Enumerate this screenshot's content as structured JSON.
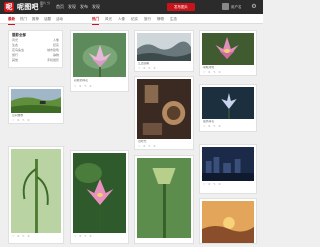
{
  "brand": {
    "logo_letter": "呢",
    "name": "呢图吧",
    "slogan": "图片 分享"
  },
  "topnav": [
    "首页",
    "发现",
    "发布",
    "发现"
  ],
  "top_search_label": "发布图片",
  "user": {
    "name": "用户名"
  },
  "subnav_left": [
    {
      "label": "最新",
      "active": true
    },
    {
      "label": "热门",
      "active": false
    },
    {
      "label": "推荐",
      "active": false
    },
    {
      "label": "话题",
      "active": false
    },
    {
      "label": "活动",
      "active": false
    }
  ],
  "subnav_right": [
    {
      "label": "热门",
      "active": true
    },
    {
      "label": "风光",
      "active": false
    },
    {
      "label": "人像",
      "active": false
    },
    {
      "label": "纪实",
      "active": false
    },
    {
      "label": "旅行",
      "active": false
    },
    {
      "label": "静物",
      "active": false
    },
    {
      "label": "生态",
      "active": false
    }
  ],
  "sidebar": {
    "title": "摄影全部",
    "rows": [
      [
        "风光",
        "人像"
      ],
      [
        "生态",
        "纪实"
      ],
      [
        "花鸟鱼虫",
        "城市建筑"
      ],
      [
        "旅行",
        "静物"
      ],
      [
        "其他",
        "手机摄影"
      ]
    ]
  },
  "cards": [
    {
      "caption": "初夏的荷花",
      "likes": "0",
      "comments": "0"
    },
    {
      "caption": "江边远眺",
      "likes": "0",
      "comments": "0"
    },
    {
      "caption": "荷塘月色",
      "likes": "0",
      "comments": "0"
    },
    {
      "caption": "山间放牧",
      "likes": "0",
      "comments": "0"
    },
    {
      "caption": "旧时光",
      "likes": "0",
      "comments": "0"
    },
    {
      "caption": "夜色荷花",
      "likes": "0",
      "comments": "0"
    },
    {
      "caption": "",
      "likes": "0",
      "comments": "0"
    },
    {
      "caption": "",
      "likes": "0",
      "comments": "0"
    },
    {
      "caption": "",
      "likes": "0",
      "comments": "0"
    },
    {
      "caption": "",
      "likes": "0",
      "comments": "0"
    },
    {
      "caption": "",
      "likes": "0",
      "comments": "0"
    }
  ],
  "icons": {
    "like": "heart-icon",
    "comment": "comment-icon"
  },
  "colors": {
    "brand_red": "#c9131b",
    "topbar": "#2b2b2b"
  }
}
